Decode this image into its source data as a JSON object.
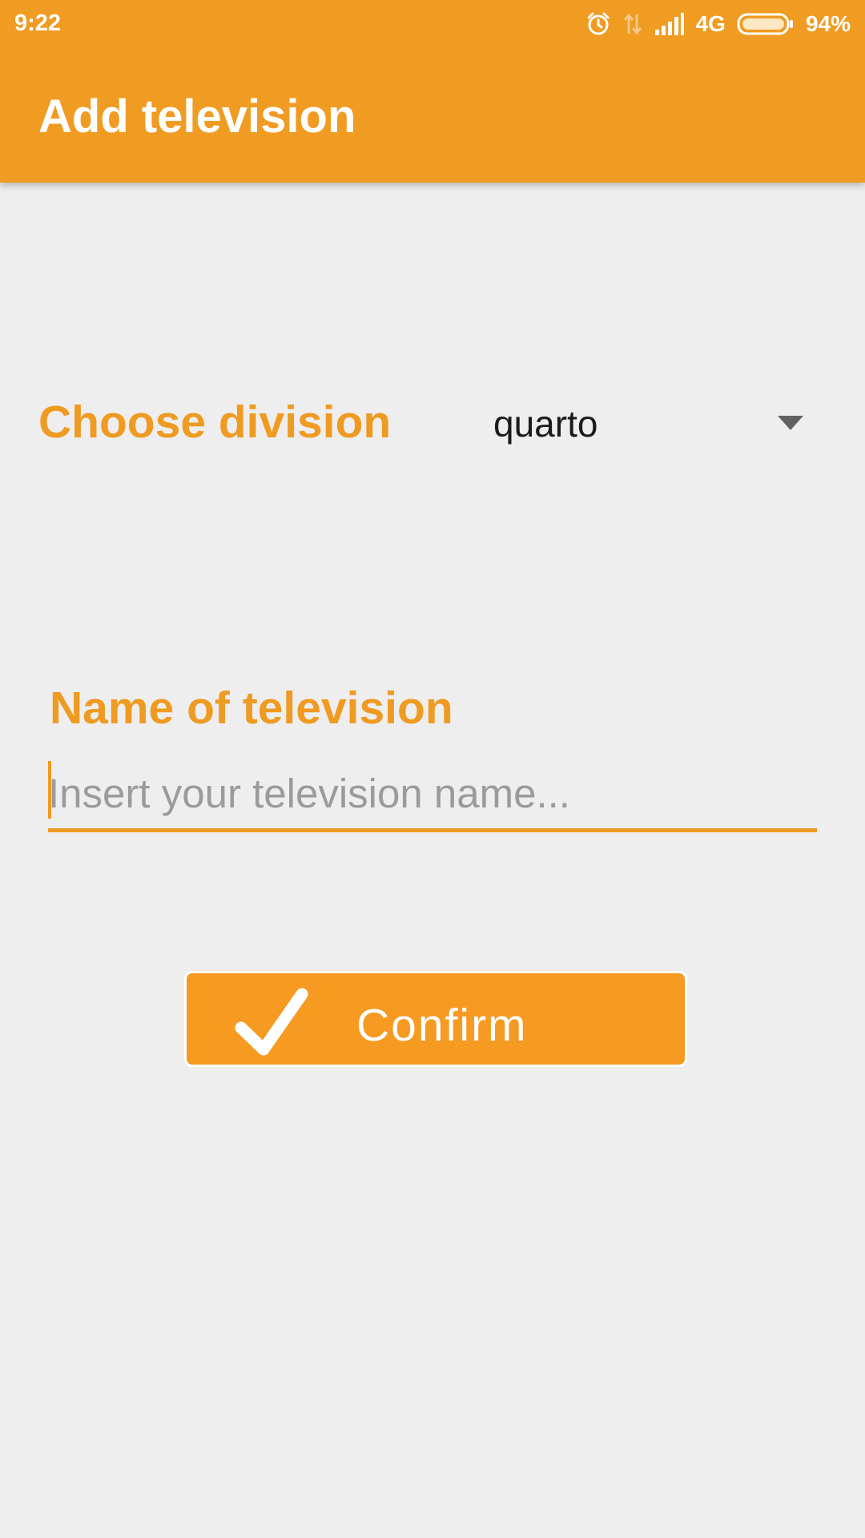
{
  "status_bar": {
    "time": "9:22",
    "network": "4G",
    "battery": "94%",
    "icons": [
      "alarm-icon",
      "data-transfer-icon",
      "signal-icon",
      "battery-icon"
    ]
  },
  "app_bar": {
    "title": "Add television",
    "color": "#f09c22"
  },
  "form": {
    "division_label": "Choose division",
    "division_selected": "quarto",
    "name_label": "Name of television",
    "name_value": "",
    "name_placeholder": "Insert your television name...",
    "label_color": "#ef9b22"
  },
  "confirm_button": {
    "label": "Confirm",
    "icon": "checkmark-icon",
    "color": "#f79a22"
  }
}
